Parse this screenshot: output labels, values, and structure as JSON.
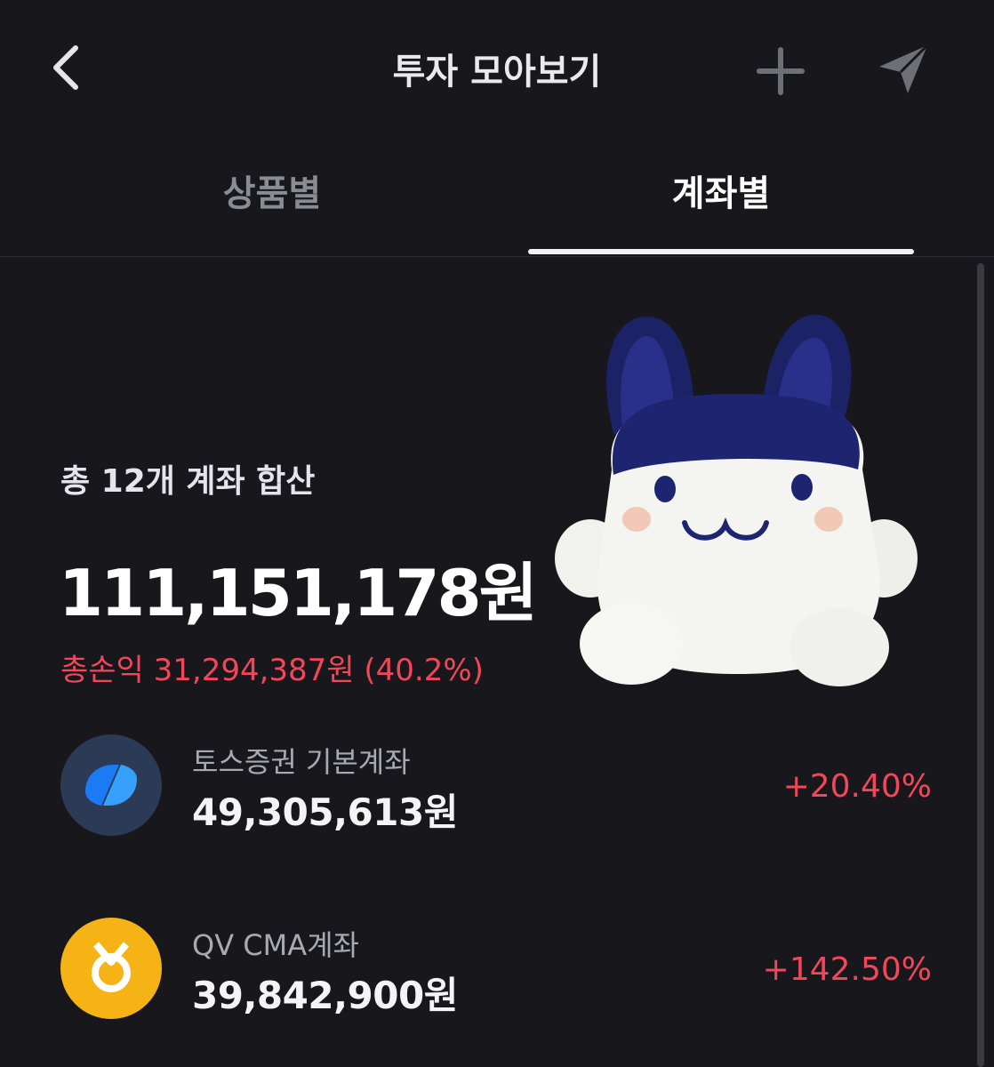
{
  "header": {
    "title": "투자 모아보기",
    "back_icon": "chevron-left-icon",
    "add_icon": "plus-icon",
    "share_icon": "send-icon"
  },
  "tabs": [
    {
      "label": "상품별",
      "active": false
    },
    {
      "label": "계좌별",
      "active": true
    }
  ],
  "summary": {
    "label": "총 12개 계좌 합산",
    "total": "111,151,178원",
    "profit": "총손익 31,294,387원 (40.2%)"
  },
  "accounts": [
    {
      "name": "토스증권 기본계좌",
      "balance": "49,305,613원",
      "rate": "+20.40%",
      "icon": "toss-logo-icon",
      "icon_color": "#2b3a55"
    },
    {
      "name": "QV CMA계좌",
      "balance": "39,842,900원",
      "rate": "+142.50%",
      "icon": "nh-logo-icon",
      "icon_color": "#f5b316"
    }
  ],
  "colors": {
    "background": "#17171c",
    "loss_profit_red": "#f2475a",
    "inactive_tab": "#8b8b94"
  }
}
